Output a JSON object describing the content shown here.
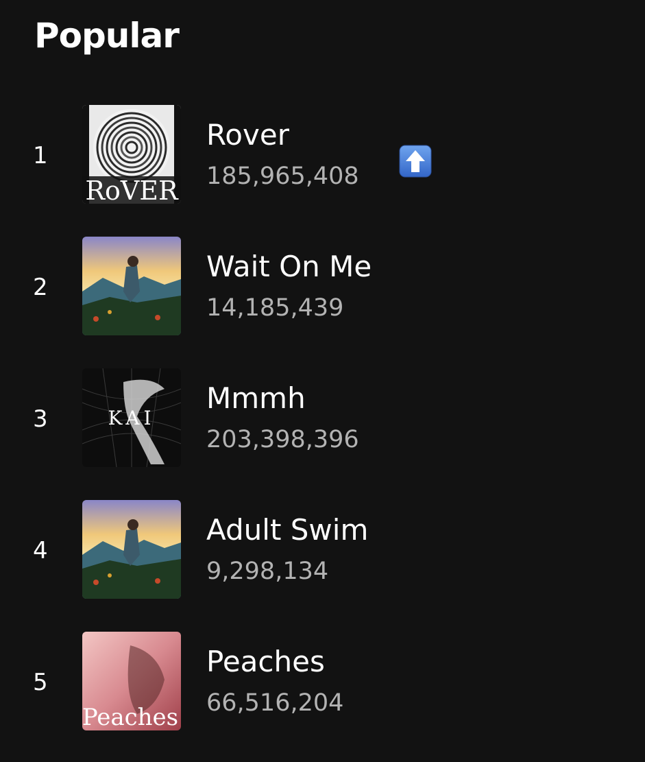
{
  "section": {
    "title": "Popular"
  },
  "tracks": [
    {
      "rank": "1",
      "title": "Rover",
      "plays": "185,965,408",
      "cover_text": "RoVER",
      "trend_icon": "up-arrow-icon"
    },
    {
      "rank": "2",
      "title": "Wait On Me",
      "plays": "14,185,439"
    },
    {
      "rank": "3",
      "title": "Mmmh",
      "plays": "203,398,396",
      "cover_text": "KAI"
    },
    {
      "rank": "4",
      "title": "Adult Swim",
      "plays": "9,298,134"
    },
    {
      "rank": "5",
      "title": "Peaches",
      "plays": "66,516,204",
      "cover_text": "Peaches"
    }
  ],
  "colors": {
    "background": "#121212",
    "text_primary": "#ffffff",
    "text_secondary": "#b3b3b3",
    "badge_blue": "#4a84d9"
  }
}
